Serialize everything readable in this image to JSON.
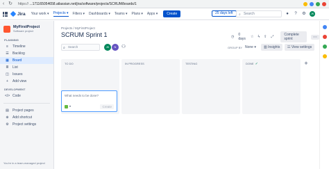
{
  "browser": {
    "url_host": "https://",
    "url_rest": "...171165054658.atlassian.net/jira/software/projects/SCRUM/boards/1"
  },
  "topnav": {
    "logo": "Jira",
    "items": [
      "Your work ▾",
      "Projects ▾",
      "Filters ▾",
      "Dashboards ▾",
      "Teams ▾",
      "Plans ▾",
      "Apps ▾"
    ],
    "create": "Create",
    "trial": "25 days left",
    "search_placeholder": "Search",
    "avatar": "JK"
  },
  "sidebar": {
    "project_name": "MyFirstProject",
    "project_type": "Software project",
    "planning_label": "PLANNING",
    "planning": [
      {
        "icon": "timeline-icon",
        "label": "Timeline"
      },
      {
        "icon": "backlog-icon",
        "label": "Backlog"
      },
      {
        "icon": "board-icon",
        "label": "Board"
      },
      {
        "icon": "list-icon",
        "label": "List"
      },
      {
        "icon": "issues-icon",
        "label": "Issues"
      },
      {
        "icon": "add-icon",
        "label": "Add view"
      }
    ],
    "development_label": "DEVELOPMENT",
    "development": [
      {
        "icon": "code-icon",
        "label": "Code"
      }
    ],
    "extra": [
      {
        "icon": "pages-icon",
        "label": "Project pages"
      },
      {
        "icon": "shortcut-icon",
        "label": "Add shortcut"
      },
      {
        "icon": "settings-icon",
        "label": "Project settings"
      }
    ],
    "footnote": "You're in a team-managed project"
  },
  "main": {
    "breadcrumb": "Projects  /  MyFirstProject",
    "title": "SCRUM Sprint 1",
    "days": "0 days",
    "complete_sprint": "Complete sprint",
    "search_placeholder": "Search",
    "avatars": [
      "JK",
      "N"
    ],
    "group_by_label": "GROUP BY",
    "group_by_value": "None ▾",
    "insights": "Insights",
    "view_settings": "View settings",
    "columns": [
      "TO DO",
      "IN PROGRESS",
      "TESTING",
      "DONE"
    ],
    "card": {
      "placeholder": "What needs to be done?",
      "create_label": "Create"
    }
  },
  "colors": {
    "accent": "#0052cc",
    "sidebar_bg": "#f4f5f7",
    "project_icon": "#ff5630"
  }
}
